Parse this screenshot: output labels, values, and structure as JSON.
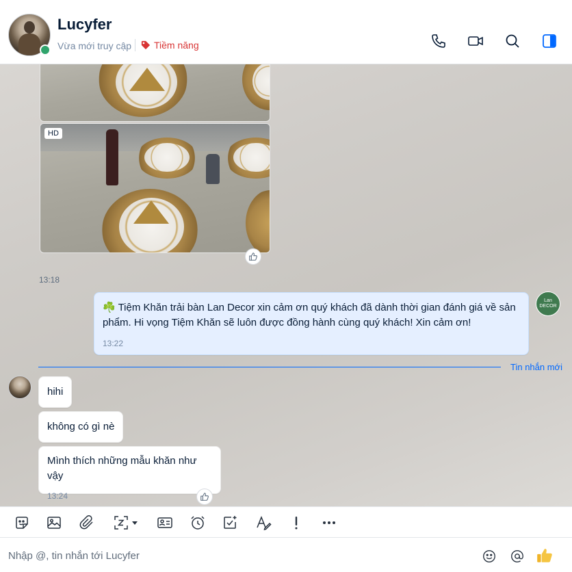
{
  "header": {
    "contact_name": "Lucyfer",
    "status": "Vừa mới truy cập",
    "tag": "Tiềm năng",
    "tag_color": "#d83434",
    "online_color": "#30a46c",
    "actions": [
      "phone-icon",
      "video-call-icon",
      "search-icon",
      "sidebar-toggle-icon"
    ]
  },
  "chat": {
    "photo_badge": "HD",
    "photo_time": "13:18",
    "outgoing": {
      "text": "☘️ Tiệm Khăn trải bàn Lan Decor xin cảm ơn quý khách đã dành thời gian đánh giá về sản phẩm. Hi vọng Tiệm Khăn sẽ luôn được đồng hành cùng quý khách! Xin cảm ơn!",
      "time": "13:22"
    },
    "shop_avatar_text": "Lan DECOR",
    "new_messages_label": "Tin nhắn mới",
    "incoming": [
      {
        "text": "hihi"
      },
      {
        "text": "không có gì nè"
      },
      {
        "text": "Mình thích những mẫu khăn như vậy",
        "time": "13:24"
      }
    ]
  },
  "toolbar": {
    "tools": [
      "sticker-icon",
      "image-icon",
      "attachment-icon",
      "screenshot-icon",
      "contact-card-icon",
      "reminder-icon",
      "task-icon",
      "format-text-icon",
      "urgent-icon",
      "more-icon"
    ]
  },
  "composer": {
    "placeholder": "Nhập @, tin nhắn tới Lucyfer",
    "accent": "#0068ff"
  }
}
